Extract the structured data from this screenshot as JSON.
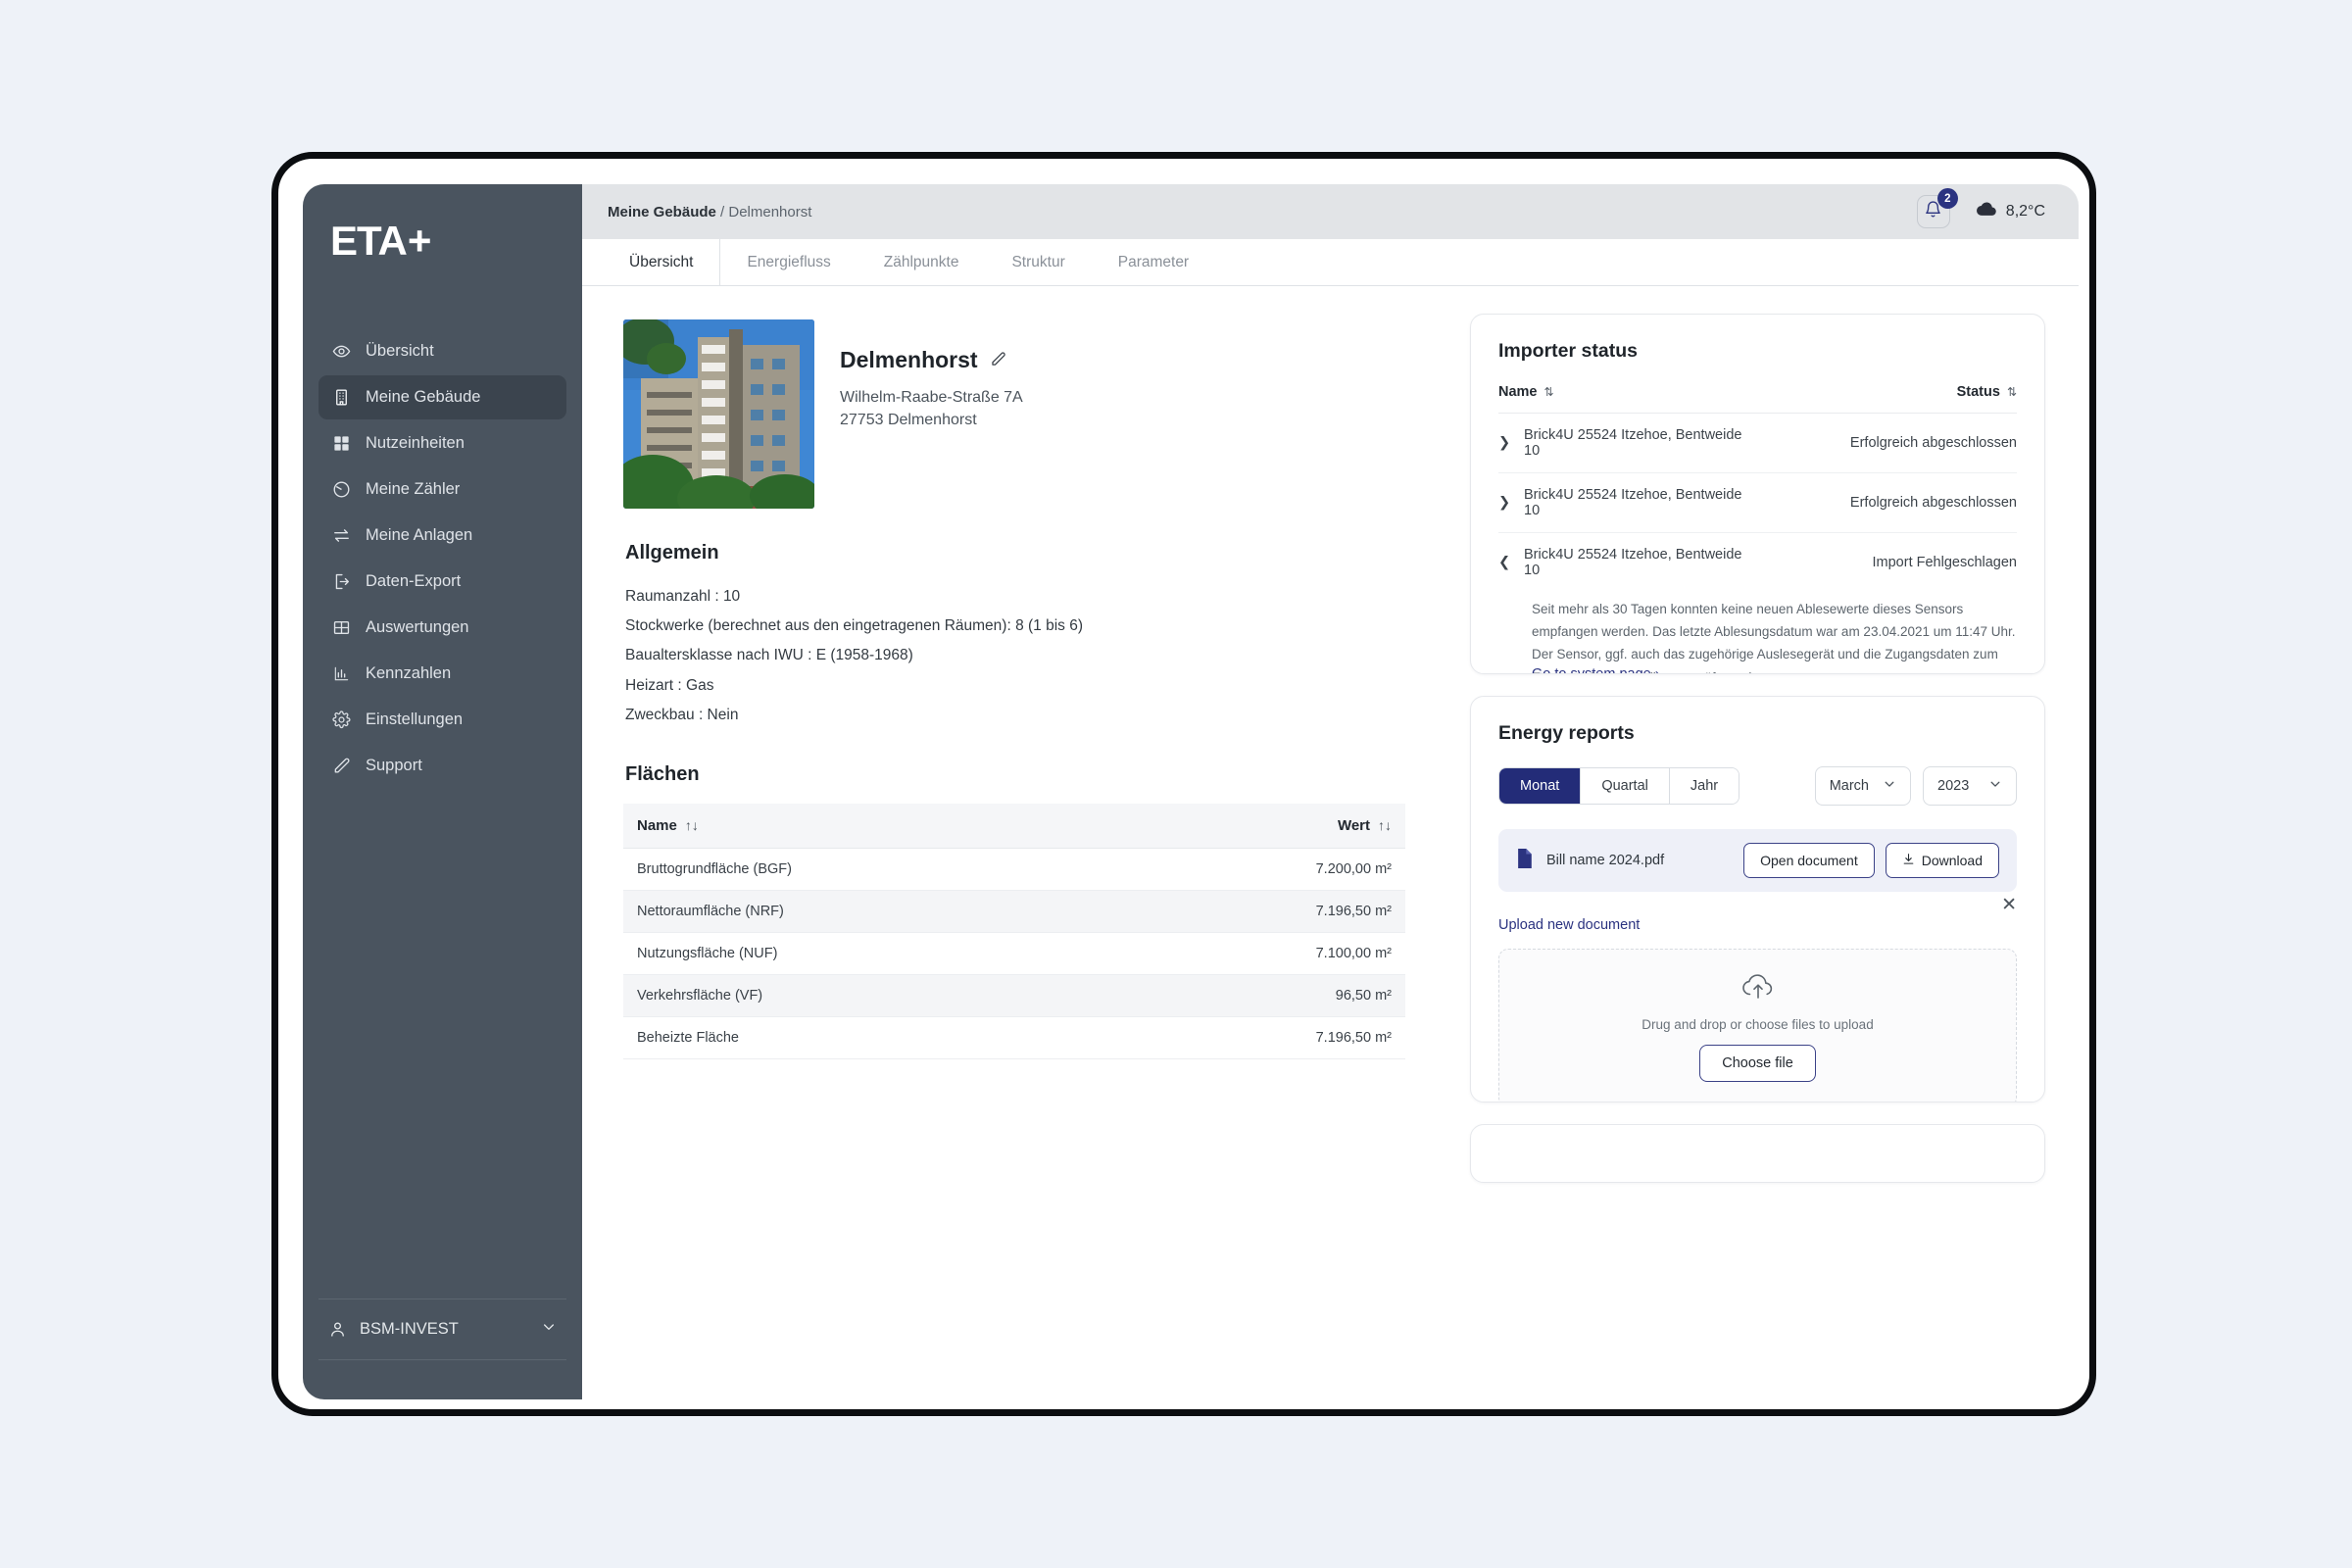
{
  "brand": {
    "name": "ETA",
    "plus": "+"
  },
  "sidebar": {
    "items": [
      {
        "label": "Übersicht",
        "icon": "eye-icon"
      },
      {
        "label": "Meine Gebäude",
        "icon": "building-icon"
      },
      {
        "label": "Nutzeinheiten",
        "icon": "grid-icon"
      },
      {
        "label": "Meine Zähler",
        "icon": "gauge-icon"
      },
      {
        "label": "Meine Anlagen",
        "icon": "transfer-icon"
      },
      {
        "label": "Daten-Export",
        "icon": "export-icon"
      },
      {
        "label": "Auswertungen",
        "icon": "table-icon"
      },
      {
        "label": "Kennzahlen",
        "icon": "bar-chart-icon"
      },
      {
        "label": "Einstellungen",
        "icon": "gear-icon"
      },
      {
        "label": "Support",
        "icon": "pencil-icon"
      }
    ],
    "account": {
      "label": "BSM-INVEST",
      "icon": "user-icon"
    }
  },
  "topbar": {
    "breadcrumb_parent": "Meine Gebäude",
    "breadcrumb_sep": "/",
    "breadcrumb_current": "Delmenhorst",
    "notification_count": "2",
    "temperature": "8,2°C"
  },
  "tabs": [
    {
      "label": "Übersicht",
      "active": true
    },
    {
      "label": "Energiefluss",
      "active": false
    },
    {
      "label": "Zählpunkte",
      "active": false
    },
    {
      "label": "Struktur",
      "active": false
    },
    {
      "label": "Parameter",
      "active": false
    }
  ],
  "building": {
    "name": "Delmenhorst",
    "street": "Wilhelm-Raabe-Straße 7A",
    "city": "27753 Delmenhorst"
  },
  "allgemein": {
    "heading": "Allgemein",
    "lines": [
      "Raumanzahl : 10",
      "Stockwerke  (berechnet aus den eingetragenen Räumen): 8 (1 bis 6)",
      "Baualtersklasse nach IWU : E (1958-1968)",
      "Heizart : Gas",
      "Zweckbau : Nein"
    ]
  },
  "flaechen": {
    "heading": "Flächen",
    "columns": [
      "Name",
      "Wert"
    ],
    "rows": [
      {
        "name": "Bruttogrundfläche (BGF)",
        "value": "7.200,00 m²"
      },
      {
        "name": "Nettoraumfläche (NRF)",
        "value": "7.196,50 m²"
      },
      {
        "name": "Nutzungsfläche (NUF)",
        "value": "7.100,00 m²"
      },
      {
        "name": "Verkehrsfläche (VF)",
        "value": "96,50 m²"
      },
      {
        "name": "Beheizte Fläche",
        "value": "7.196,50 m²"
      }
    ]
  },
  "importer": {
    "title": "Importer status",
    "columns": [
      "Name",
      "Status"
    ],
    "rows": [
      {
        "name": "Brick4U 25524 Itzehoe, Bentweide 10",
        "status": "Erfolgreich abgeschlossen",
        "state": "ok",
        "expanded": false
      },
      {
        "name": "Brick4U 25524 Itzehoe, Bentweide 10",
        "status": "Erfolgreich abgeschlossen",
        "state": "ok",
        "expanded": false
      },
      {
        "name": "Brick4U 25524 Itzehoe, Bentweide 10",
        "status": "Import Fehlgeschlagen",
        "state": "error",
        "expanded": true
      }
    ],
    "error_detail": "Seit mehr als 30 Tagen konnten keine neuen Ablesewerte dieses Sensors empfangen werden. Das letzte Ablesungsdatum war am 23.04.2021 um 11:47 Uhr. Der Sensor, ggf. auch das zugehörige Auslesegerät und die Zugangsdaten zum Externen System sollten geprüft werden.",
    "system_link": "Go to system page  ›"
  },
  "reports": {
    "title": "Energy reports",
    "segments": [
      {
        "label": "Monat",
        "active": true
      },
      {
        "label": "Quartal",
        "active": false
      },
      {
        "label": "Jahr",
        "active": false
      }
    ],
    "month_value": "March",
    "year_value": "2023",
    "file": {
      "name": "Bill name 2024.pdf",
      "open_label": "Open document",
      "download_label": "Download"
    },
    "upload_label": "Upload new document",
    "dropzone_text": "Drug and drop or choose files to upload",
    "choose_label": "Choose file"
  },
  "colors": {
    "sidebar_bg": "#4a545f",
    "accent_navy": "#232c78",
    "status_ok": "#54bd95",
    "status_error": "#e05a6b",
    "page_bg": "#eef2f8"
  }
}
